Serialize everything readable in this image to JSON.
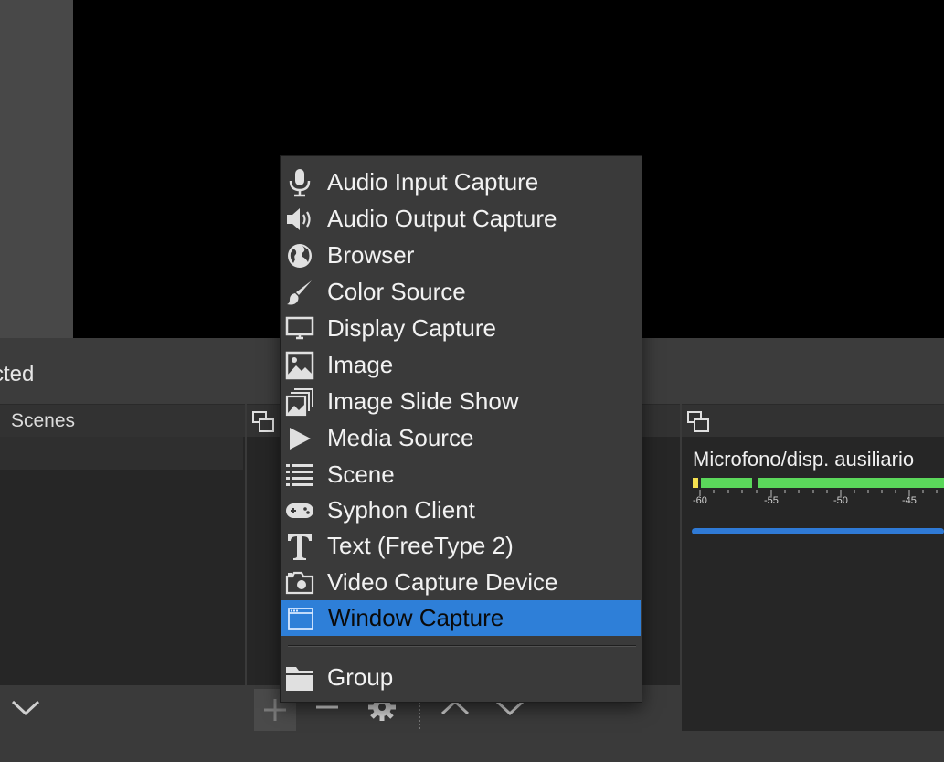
{
  "status": {
    "text": "cted"
  },
  "scenes_dock": {
    "title": "Scenes"
  },
  "mixer": {
    "channel_name": "Microfono/disp. ausiliario",
    "tick_labels": [
      "-60",
      "-55",
      "-50",
      "-45"
    ],
    "accent": "#2f7ad6",
    "meter_color": "#5bd85b"
  },
  "context_menu": {
    "items": [
      {
        "label": "Audio Input Capture",
        "icon": "microphone-icon"
      },
      {
        "label": "Audio Output Capture",
        "icon": "speaker-icon"
      },
      {
        "label": "Browser",
        "icon": "globe-icon"
      },
      {
        "label": "Color Source",
        "icon": "paintbrush-icon"
      },
      {
        "label": "Display Capture",
        "icon": "monitor-icon"
      },
      {
        "label": "Image",
        "icon": "image-icon"
      },
      {
        "label": "Image Slide Show",
        "icon": "slideshow-icon"
      },
      {
        "label": "Media Source",
        "icon": "play-icon"
      },
      {
        "label": "Scene",
        "icon": "list-icon"
      },
      {
        "label": "Syphon Client",
        "icon": "gamepad-icon"
      },
      {
        "label": "Text (FreeType 2)",
        "icon": "text-icon"
      },
      {
        "label": "Video Capture Device",
        "icon": "camera-icon"
      },
      {
        "label": "Window Capture",
        "icon": "window-icon",
        "selected": true
      },
      {
        "label": "Group",
        "icon": "folder-icon"
      }
    ],
    "selected_color": "#2e7fd8"
  },
  "icons": {
    "sources_footer": [
      "add-icon",
      "remove-icon",
      "gear-icon",
      "move-up-icon",
      "move-down-icon"
    ],
    "scenes_footer": [
      "move-down-icon"
    ],
    "dock_undock": "undock-icon"
  }
}
